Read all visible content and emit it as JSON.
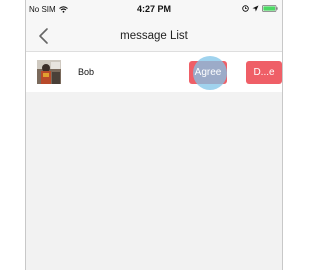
{
  "status_bar": {
    "carrier": "No SIM",
    "time": "4:27 PM",
    "icons": [
      "wifi-icon",
      "location-icon",
      "alarm-icon",
      "battery-icon"
    ],
    "battery_color": "#4cd964"
  },
  "nav": {
    "title": "message List",
    "back_icon": "chevron-left-icon"
  },
  "messages": [
    {
      "name": "Bob",
      "agree_label": "Agree",
      "decline_label": "D...e"
    }
  ],
  "colors": {
    "button": "#ef5f67",
    "touch_indicator": "#80c4e8",
    "background": "#f2f2f2"
  }
}
